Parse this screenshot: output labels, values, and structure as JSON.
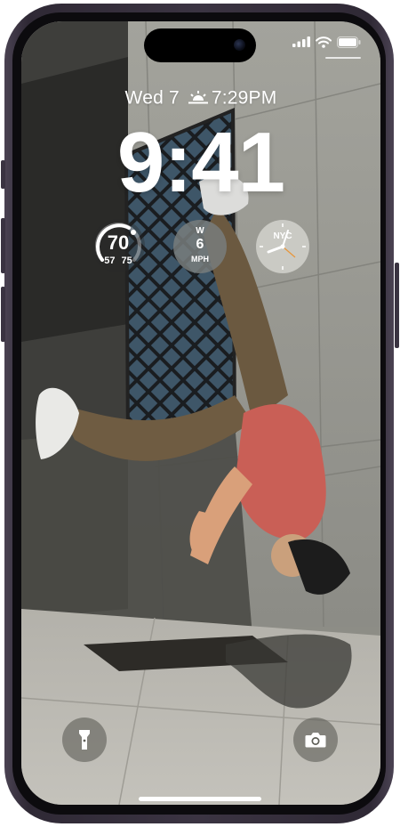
{
  "lock_screen": {
    "date": "Wed 7",
    "sunset_time": "7:29PM",
    "time": "9:41"
  },
  "widgets": {
    "temperature": {
      "current": "70",
      "low": "57",
      "high": "75"
    },
    "wind": {
      "direction": "W",
      "speed": "6",
      "unit": "MPH"
    },
    "world_clock": {
      "city": "NYC"
    }
  },
  "bottom_controls": {
    "left": "flashlight-icon",
    "right": "camera-icon"
  },
  "colors": {
    "frame": "#3b3442",
    "text": "#ffffff"
  }
}
